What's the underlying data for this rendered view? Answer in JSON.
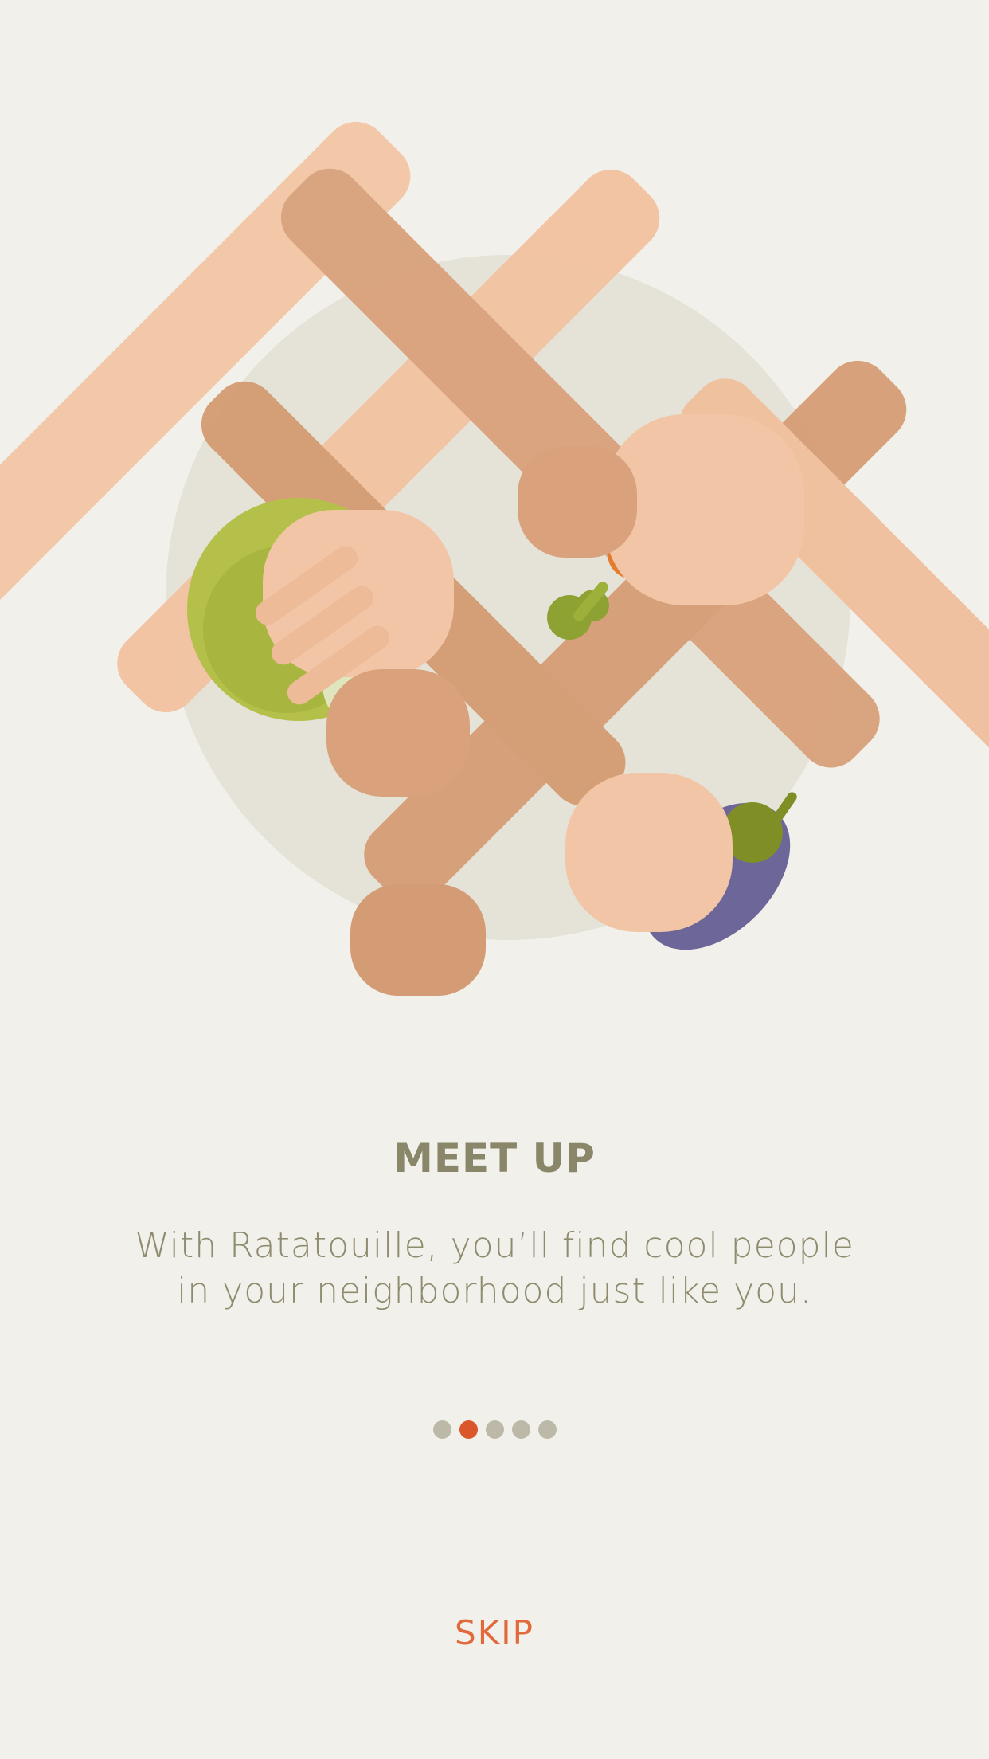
{
  "onboarding": {
    "title": "MEET UP",
    "description_lines": [
      "With Ratatouille, you’ll find cool people",
      "in your neighborhood just like you."
    ],
    "pager": {
      "count": 5,
      "active_index": 1,
      "active_color": "#d9572b",
      "inactive_color": "#bdb9a8"
    },
    "skip_label": "SKIP"
  },
  "colors": {
    "background": "#f2f0ea",
    "title": "#8a8669",
    "accent": "#e06a3b"
  },
  "illustration": {
    "subject": "hands-holding-vegetables",
    "items": [
      "cabbage-icon",
      "carrot-icon",
      "broccoli-icon",
      "eggplant-icon"
    ]
  }
}
